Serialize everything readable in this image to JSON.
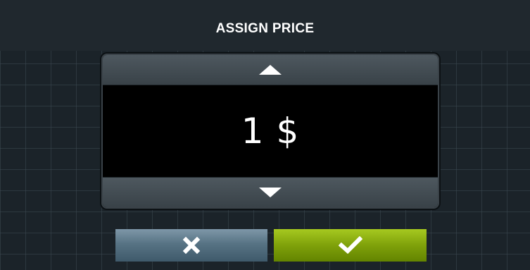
{
  "dialog": {
    "title": "ASSIGN PRICE"
  },
  "price_spinner": {
    "value": "1 $",
    "increment_icon": "triangle-up-icon",
    "decrement_icon": "triangle-down-icon"
  },
  "actions": {
    "cancel_icon": "cross-icon",
    "confirm_icon": "checkmark-icon",
    "cancel_color": "#5a7688",
    "confirm_color": "#7fa10a"
  },
  "colors": {
    "background": "#1b2329",
    "display": "#000000",
    "text": "#ffffff"
  }
}
